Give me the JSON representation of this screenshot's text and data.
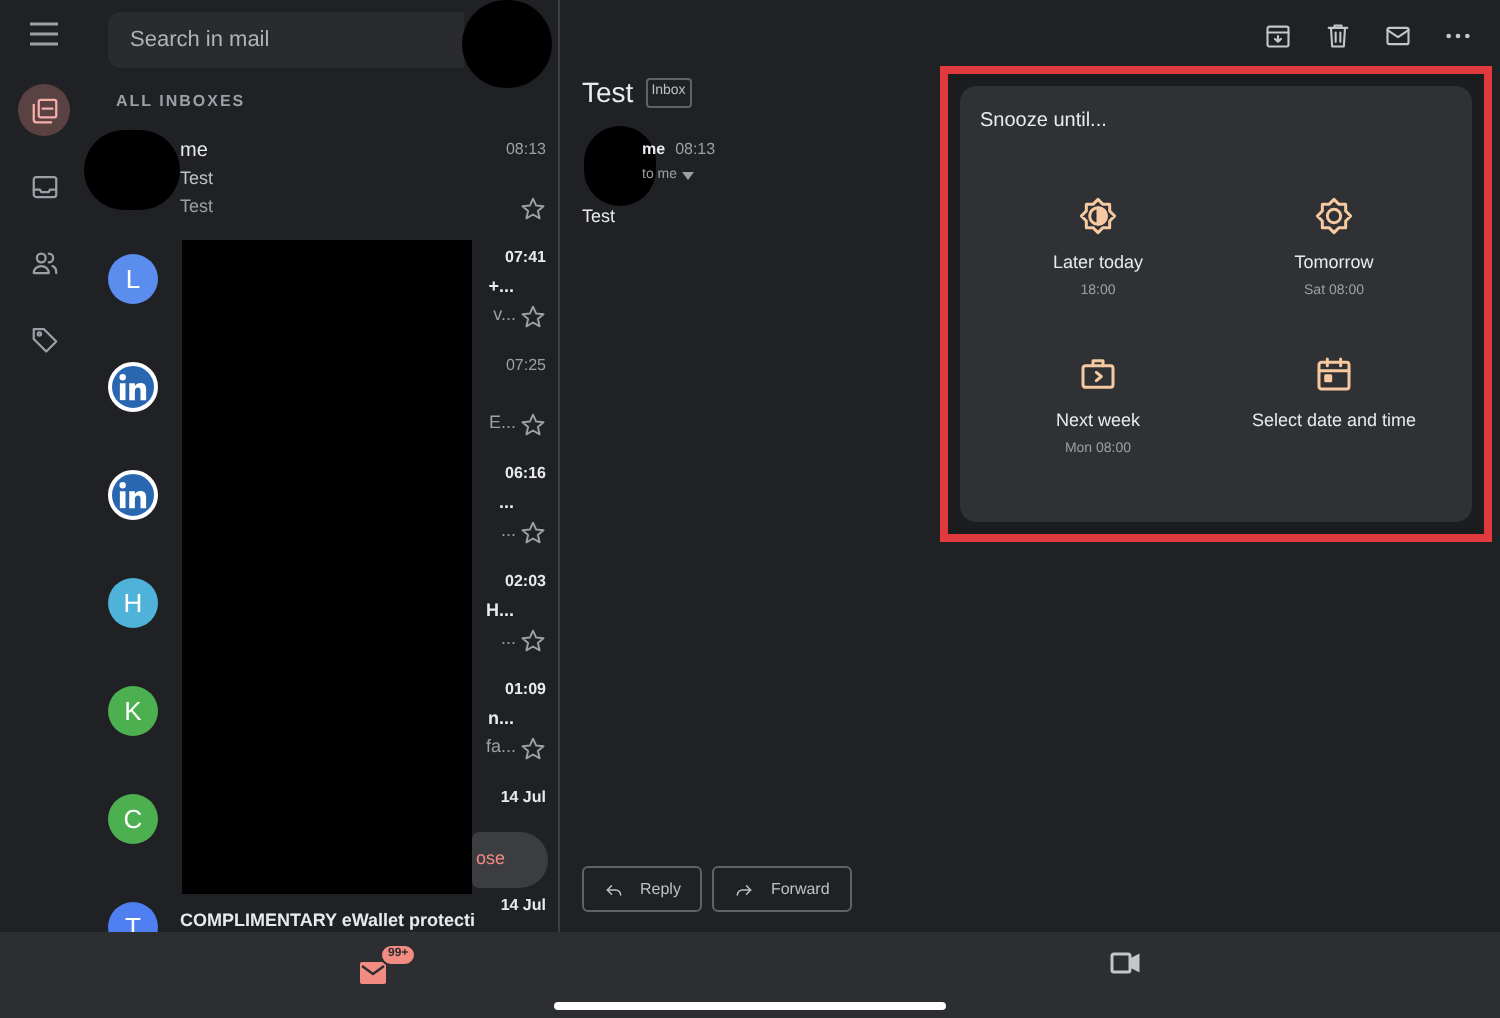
{
  "rail": {
    "items": [
      {
        "selected": true
      },
      {
        "selected": false
      },
      {
        "selected": false
      },
      {
        "selected": false
      }
    ]
  },
  "search": {
    "placeholder": "Search in mail"
  },
  "list": {
    "heading": "ALL INBOXES",
    "rows": [
      {
        "kind": "photo",
        "color": "#000000",
        "sender": "me",
        "time": "08:13",
        "subject": "Test",
        "snippet": "Test",
        "unread": false
      },
      {
        "kind": "letter",
        "letter": "L",
        "color": "#5b8def",
        "time": "07:41",
        "subject": "+...",
        "snippet": "v...",
        "unread": true
      },
      {
        "kind": "linkedin",
        "color": "#2a67b1",
        "time": "07:25",
        "snippet": "E...",
        "unread": false
      },
      {
        "kind": "linkedin",
        "color": "#2a67b1",
        "time": "06:16",
        "subject": "...",
        "snippet": "...",
        "unread": true
      },
      {
        "kind": "letter",
        "letter": "H",
        "color": "#4fb3d9",
        "time": "02:03",
        "subject": "H...",
        "snippet": "...",
        "unread": true
      },
      {
        "kind": "letter",
        "letter": "K",
        "color": "#4caf50",
        "time": "01:09",
        "subject": "n...",
        "snippet": "fa...",
        "unread": true
      },
      {
        "kind": "letter",
        "letter": "C",
        "color": "#4caf50",
        "time": "14 Jul",
        "unread": true
      },
      {
        "kind": "letter",
        "letter": "T",
        "color": "#4f7ff0",
        "time": "14 Jul",
        "subject": "COMPLIMENTARY eWallet protecti",
        "unread": true
      }
    ]
  },
  "compose": {
    "label": "ose"
  },
  "message": {
    "subject": "Test",
    "label": "Inbox",
    "sender": "me",
    "time": "08:13",
    "recipient": "to me",
    "body": "Test"
  },
  "actions": [
    {
      "label": "Reply"
    },
    {
      "label": "Forward"
    }
  ],
  "snooze": {
    "title": "Snooze until...",
    "options": [
      {
        "label": "Later today",
        "detail": "18:00"
      },
      {
        "label": "Tomorrow",
        "detail": "Sat 08:00"
      },
      {
        "label": "Next week",
        "detail": "Mon 08:00"
      },
      {
        "label": "Select date and time"
      }
    ]
  },
  "bottom_bar": {
    "badge": "99+"
  }
}
